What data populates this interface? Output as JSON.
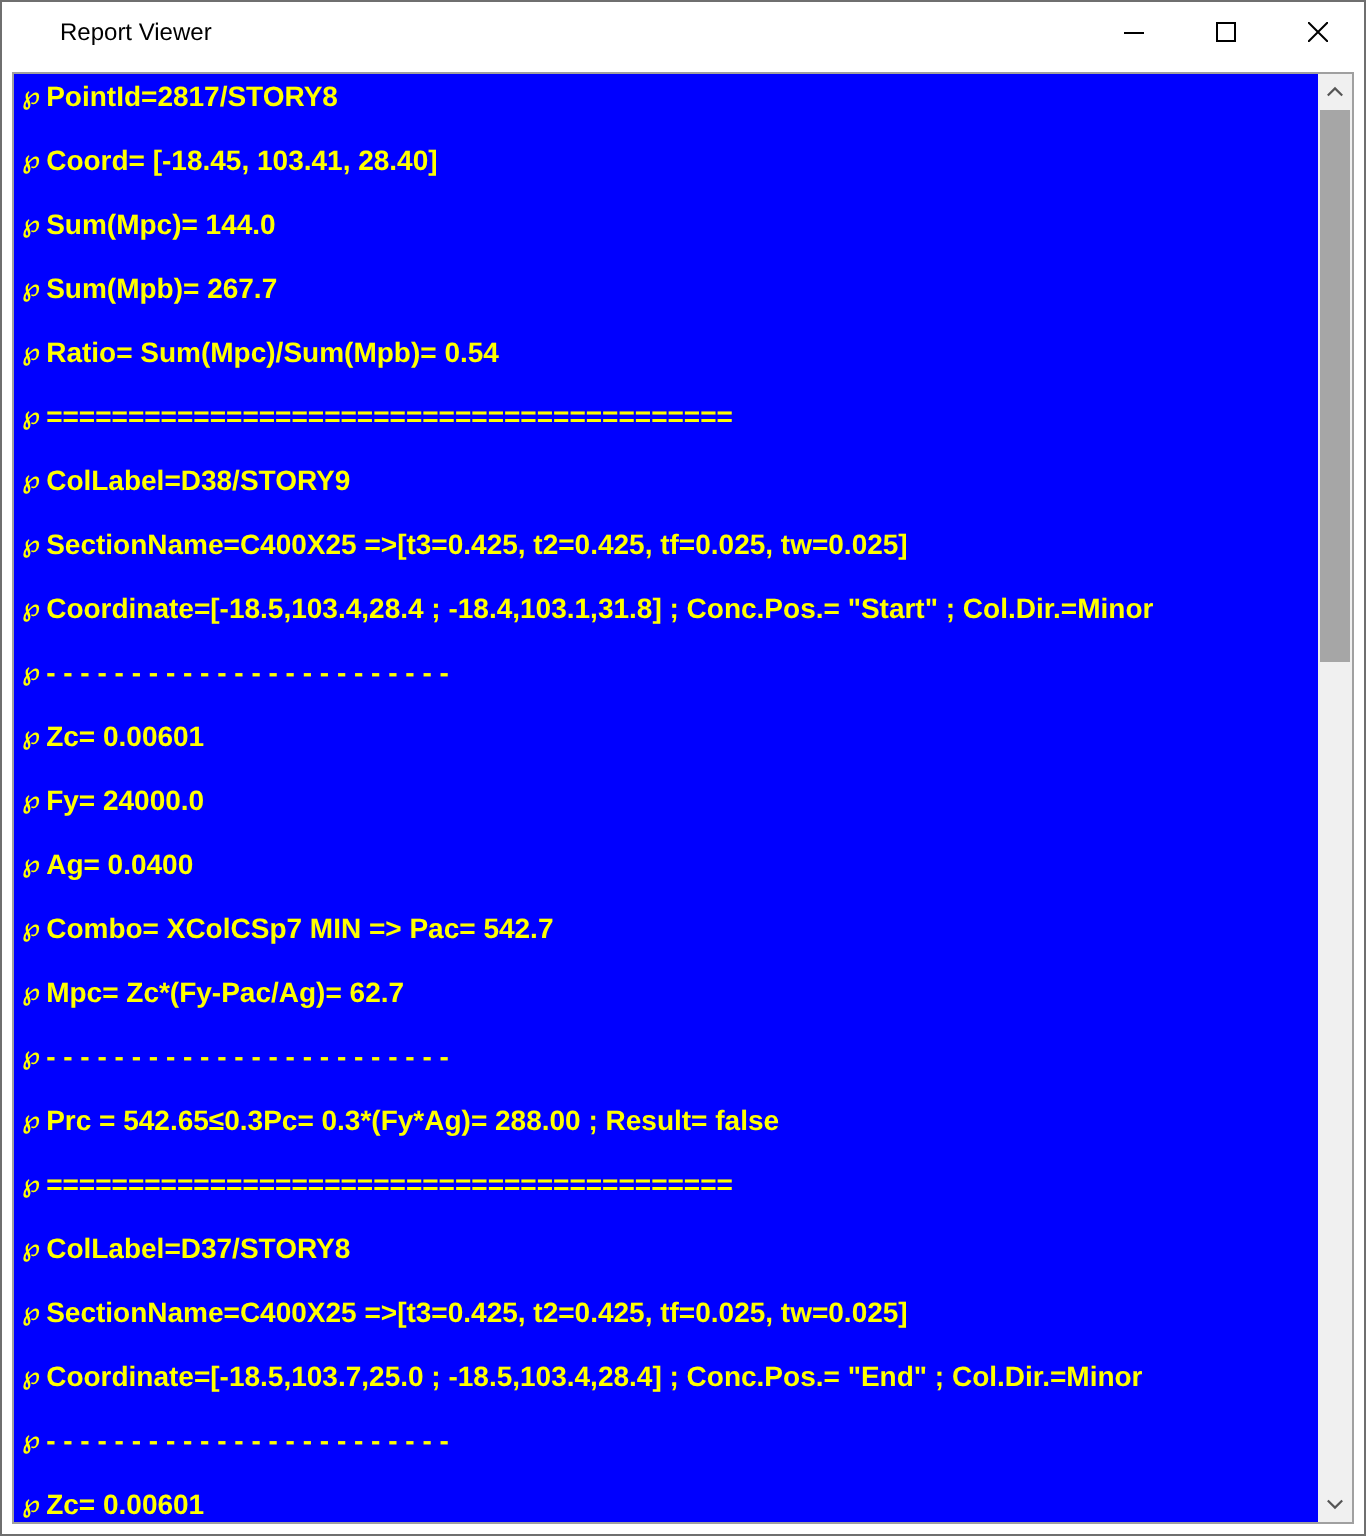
{
  "window": {
    "title": "Report Viewer"
  },
  "lines": [
    {
      "bullet": "℘",
      "text": "PointId=2817/STORY8"
    },
    {
      "bullet": "℘",
      "text": "Coord= [-18.45, 103.41, 28.40]"
    },
    {
      "bullet": "℘",
      "text": "Sum(Mpc)= 144.0"
    },
    {
      "bullet": "℘",
      "text": "Sum(Mpb)= 267.7"
    },
    {
      "bullet": "℘",
      "text": "Ratio= Sum(Mpc)/Sum(Mpb)= 0.54"
    },
    {
      "bullet": "℘",
      "text": "=========================================="
    },
    {
      "bullet": "℘",
      "text": "ColLabel=D38/STORY9"
    },
    {
      "bullet": "℘",
      "text": "SectionName=C400X25 =>[t3=0.425, t2=0.425, tf=0.025, tw=0.025]"
    },
    {
      "bullet": "℘",
      "text": "Coordinate=[-18.5,103.4,28.4 ; -18.4,103.1,31.8] ; Conc.Pos.= \"Start\" ; Col.Dir.=Minor"
    },
    {
      "bullet": "℘",
      "text": "- - - - - - - - - - - - - - - - - - - - - - - -"
    },
    {
      "bullet": "℘",
      "text": "Zc= 0.00601"
    },
    {
      "bullet": "℘",
      "text": "Fy= 24000.0"
    },
    {
      "bullet": "℘",
      "text": "Ag= 0.0400"
    },
    {
      "bullet": "℘",
      "text": "Combo= XColCSp7 MIN => Pac= 542.7"
    },
    {
      "bullet": "℘",
      "text": "Mpc= Zc*(Fy-Pac/Ag)= 62.7"
    },
    {
      "bullet": "℘",
      "text": "- - - - - - - - - - - - - - - - - - - - - - - -"
    },
    {
      "bullet": "℘",
      "text": "Prc = 542.65≤0.3Pc= 0.3*(Fy*Ag)= 288.00 ; Result= false"
    },
    {
      "bullet": "℘",
      "text": "=========================================="
    },
    {
      "bullet": "℘",
      "text": "ColLabel=D37/STORY8"
    },
    {
      "bullet": "℘",
      "text": "SectionName=C400X25 =>[t3=0.425, t2=0.425, tf=0.025, tw=0.025]"
    },
    {
      "bullet": "℘",
      "text": "Coordinate=[-18.5,103.7,25.0 ; -18.5,103.4,28.4] ; Conc.Pos.= \"End\" ; Col.Dir.=Minor"
    },
    {
      "bullet": "℘",
      "text": "- - - - - - - - - - - - - - - - - - - - - - - -"
    },
    {
      "bullet": "℘",
      "text": "Zc= 0.00601"
    }
  ]
}
